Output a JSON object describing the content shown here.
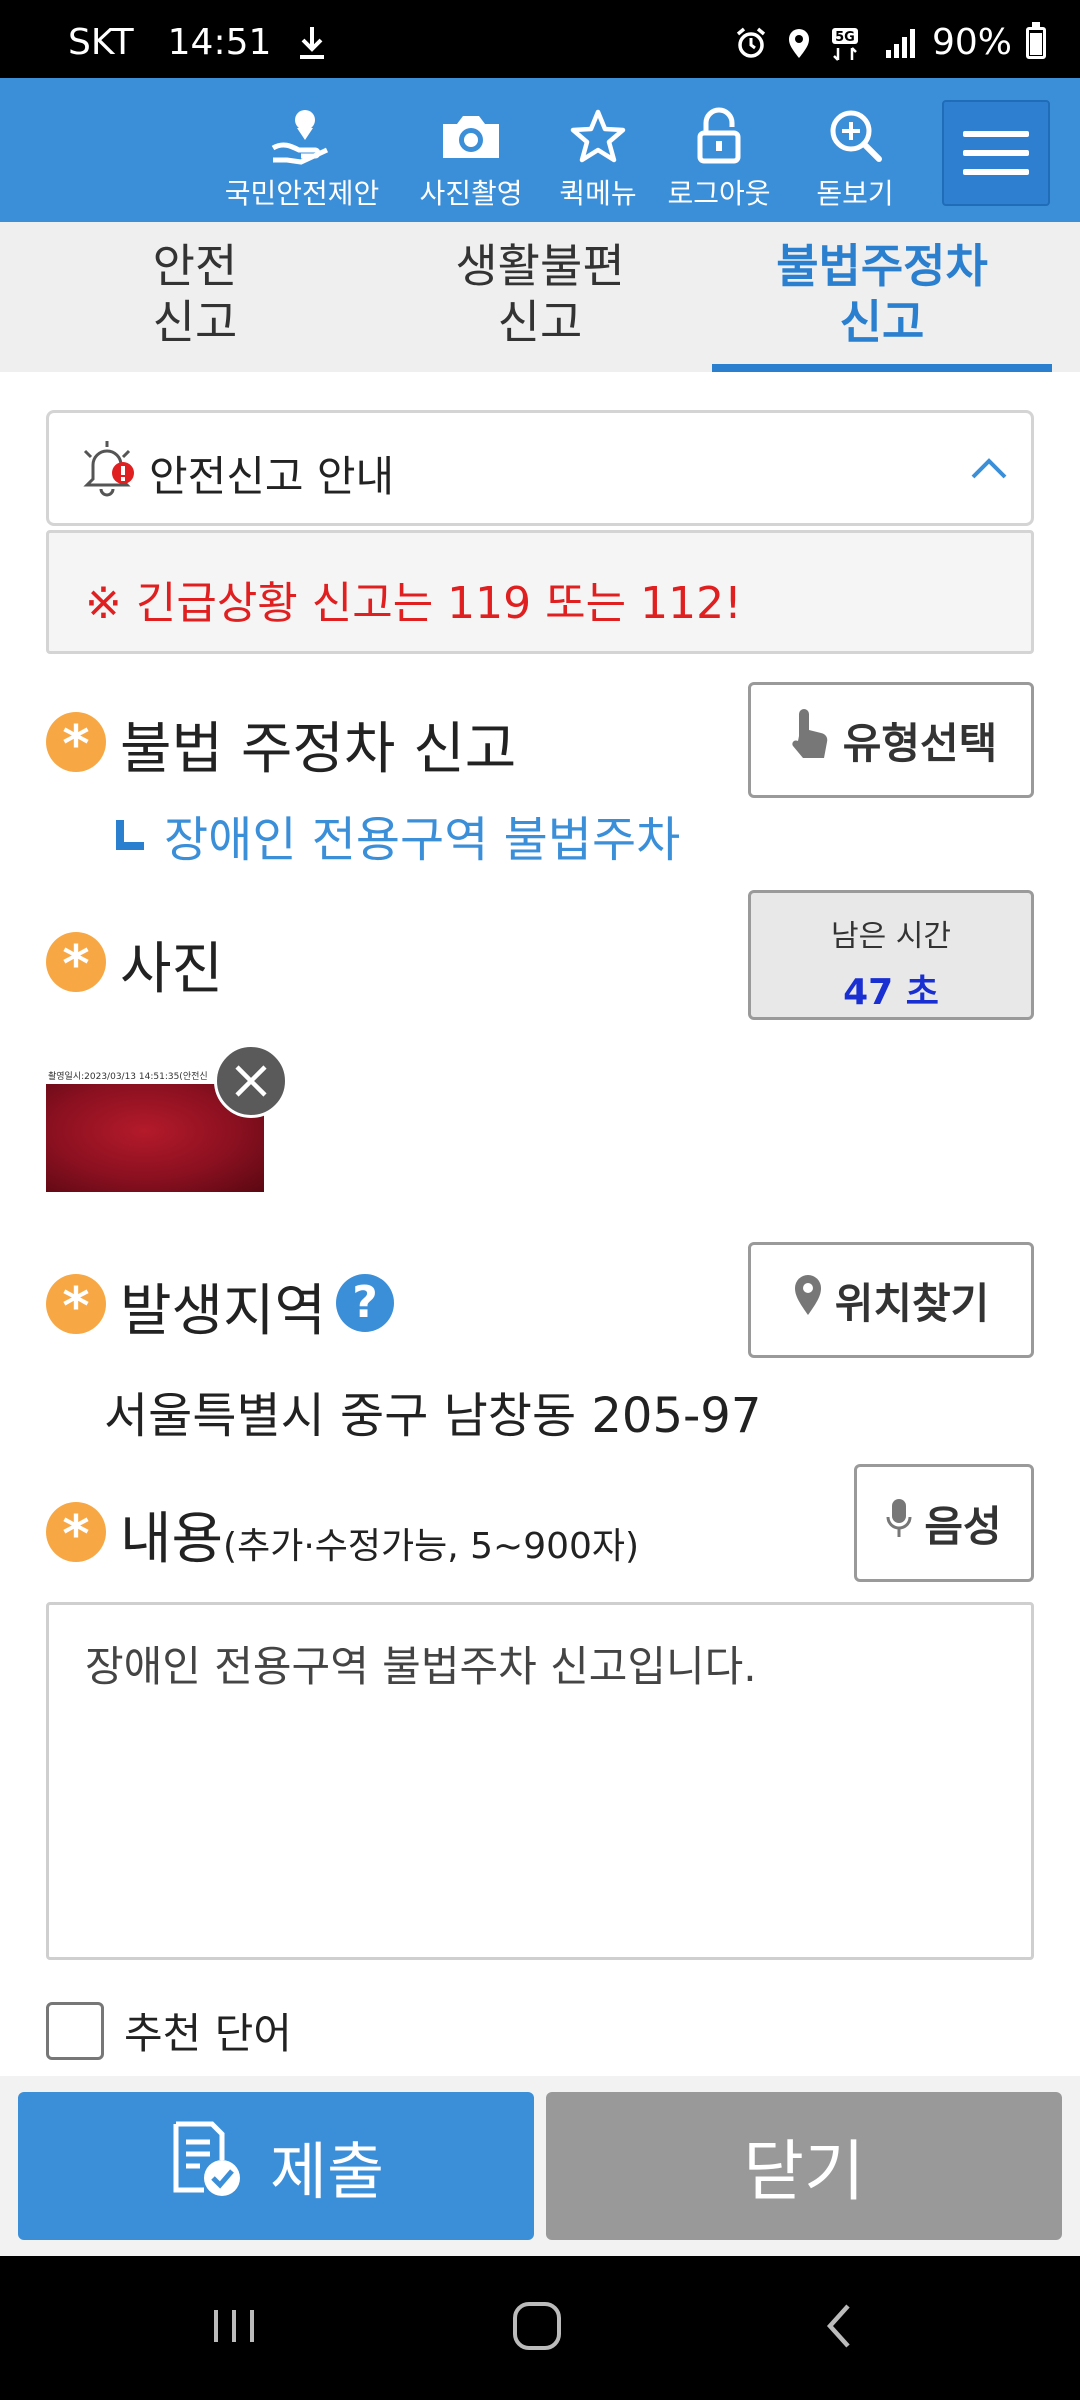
{
  "status_bar": {
    "carrier": "SKT",
    "time": "14:51",
    "network": "5G",
    "battery": "90%"
  },
  "appbar": {
    "items": [
      {
        "label": "국민안전제안",
        "icon": "hand-heart-icon"
      },
      {
        "label": "사진촬영",
        "icon": "camera-icon"
      },
      {
        "label": "퀵메뉴",
        "icon": "star-icon"
      },
      {
        "label": "로그아웃",
        "icon": "lock-icon"
      },
      {
        "label": "돋보기",
        "icon": "zoom-in-icon"
      }
    ],
    "menu_icon": "hamburger-menu-icon"
  },
  "tabs": [
    {
      "line1": "안전",
      "line2": "신고"
    },
    {
      "line1": "생활불편",
      "line2": "신고"
    },
    {
      "line1": "불법주정차",
      "line2": "신고",
      "active": true
    }
  ],
  "notice": {
    "title": "안전신고 안내",
    "emergency": "※ 긴급상황 신고는 119 또는 112!"
  },
  "report_type": {
    "title": "불법 주정차 신고",
    "button": "유형선택",
    "selected": "장애인 전용구역 불법주차"
  },
  "photo": {
    "title": "사진",
    "timer_label": "남은 시간",
    "timer_value": "47 초",
    "stamp": "촬영일시:2023/03/13 14:51:35(안전신"
  },
  "location": {
    "title": "발생지역",
    "help": "?",
    "button": "위치찾기",
    "address": "서울특별시 중구 남창동 205-97"
  },
  "content": {
    "title": "내용",
    "hint": "(추가·수정가능, 5~900자)",
    "voice_button": "음성",
    "text": "장애인 전용구역 불법주차 신고입니다."
  },
  "recommend": {
    "label": "추천 단어"
  },
  "actions": {
    "submit": "제출",
    "close": "닫기"
  },
  "colors": {
    "brand_blue": "#3b8fd9",
    "required_star": "#f7a845",
    "emergency_red": "#e02020",
    "timer_blue": "#1a2fd1"
  }
}
